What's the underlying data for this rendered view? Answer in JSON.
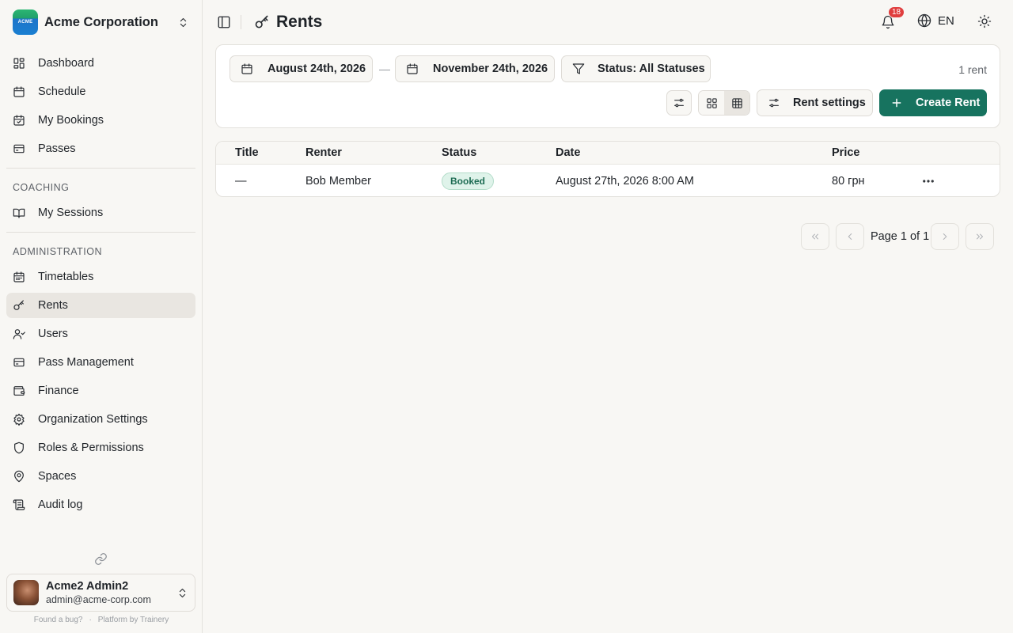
{
  "org": {
    "name": "Acme Corporation",
    "logo_text": "ACME"
  },
  "sidebar": {
    "main_items": [
      {
        "label": "Dashboard",
        "icon": "dashboard-icon"
      },
      {
        "label": "Schedule",
        "icon": "calendar-icon"
      },
      {
        "label": "My Bookings",
        "icon": "calendar-check-icon"
      },
      {
        "label": "Passes",
        "icon": "ticket-icon"
      }
    ],
    "coaching_title": "Coaching",
    "coaching_items": [
      {
        "label": "My Sessions",
        "icon": "book-icon"
      }
    ],
    "admin_title": "Administration",
    "admin_items": [
      {
        "label": "Timetables",
        "icon": "timetable-icon"
      },
      {
        "label": "Rents",
        "icon": "key-icon",
        "active": true
      },
      {
        "label": "Users",
        "icon": "users-icon"
      },
      {
        "label": "Pass Management",
        "icon": "ticket-icon"
      },
      {
        "label": "Finance",
        "icon": "wallet-icon"
      },
      {
        "label": "Organization Settings",
        "icon": "gear-icon"
      },
      {
        "label": "Roles & Permissions",
        "icon": "shield-icon"
      },
      {
        "label": "Spaces",
        "icon": "map-pin-icon"
      },
      {
        "label": "Audit log",
        "icon": "scroll-icon"
      }
    ]
  },
  "user": {
    "name": "Acme2 Admin2",
    "email": "admin@acme-corp.com"
  },
  "footer": {
    "bug_link": "Found a bug?",
    "separator": "·",
    "platform": "Platform by Trainery"
  },
  "header": {
    "title": "Rents",
    "notification_count": "18",
    "language": "EN"
  },
  "filters": {
    "date_from": "August 24th, 2026",
    "date_separator": "—",
    "date_to": "November 24th, 2026",
    "status": "Status: All Statuses",
    "count": "1 rent"
  },
  "toolbar": {
    "rent_settings_label": "Rent settings",
    "create_label": "Create Rent",
    "view_mode": "table"
  },
  "table": {
    "columns": [
      "Title",
      "Renter",
      "Status",
      "Date",
      "Price"
    ],
    "rows": [
      {
        "title": "—",
        "renter": "Bob Member",
        "status": "Booked",
        "date": "August 27th, 2026 8:00 AM",
        "price": "80 грн"
      }
    ]
  },
  "pagination": {
    "label": "Page 1 of 1"
  },
  "colors": {
    "accent": "#17735f",
    "badge": "#e03e3e",
    "status_booked_bg": "#dff3ea",
    "status_booked_text": "#1c6b52"
  }
}
